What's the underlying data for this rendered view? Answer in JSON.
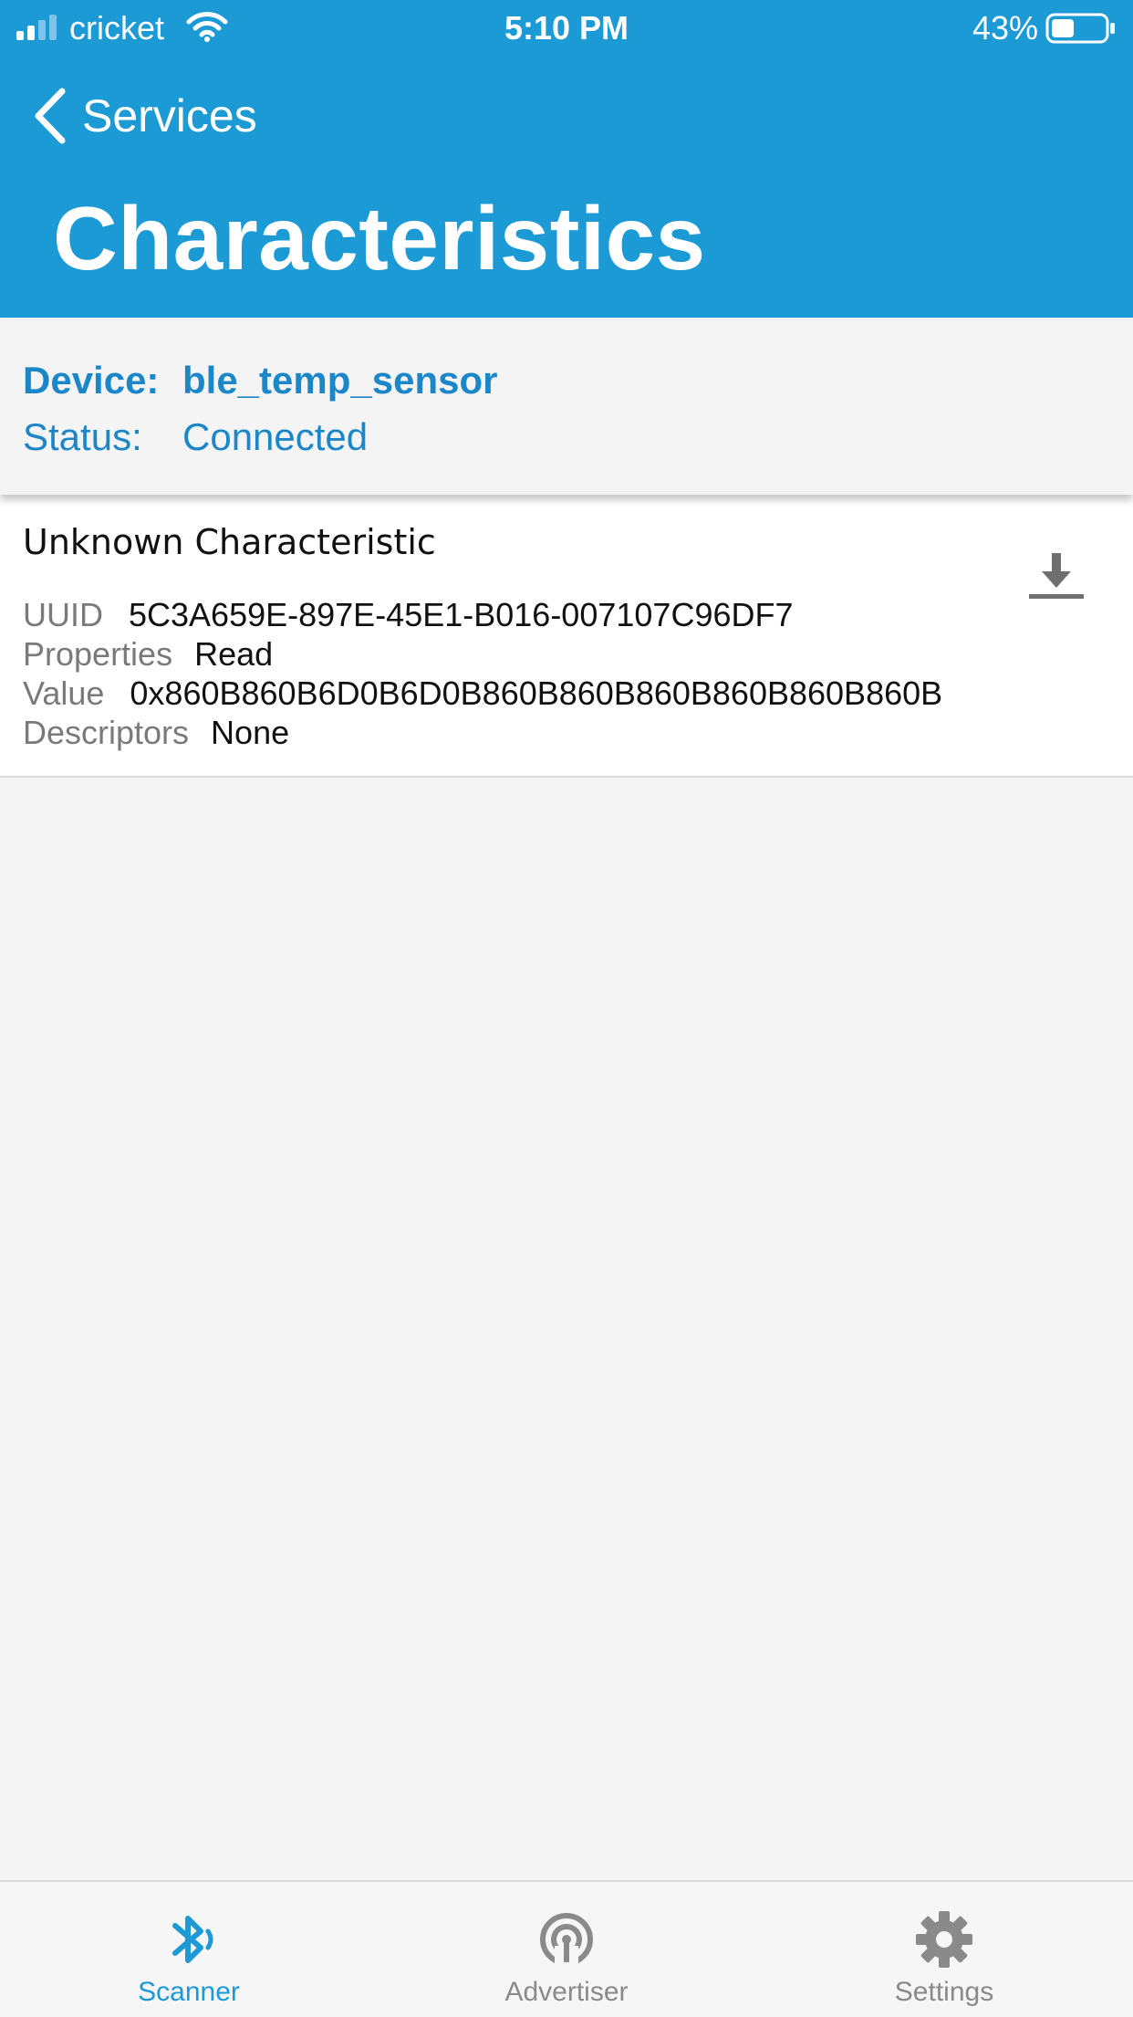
{
  "status_bar": {
    "carrier": "cricket",
    "time": "5:10 PM",
    "battery_percent": "43%",
    "battery_level": 0.43
  },
  "nav": {
    "back_label": "Services",
    "title": "Characteristics"
  },
  "device_info": {
    "device_key": "Device:",
    "device_value": "ble_temp_sensor",
    "status_key": "Status:",
    "status_value": "Connected"
  },
  "characteristics": [
    {
      "name": "Unknown Characteristic",
      "uuid_key": "UUID",
      "uuid": "5C3A659E-897E-45E1-B016-007107C96DF7",
      "properties_key": "Properties",
      "properties": "Read",
      "value_key": "Value",
      "value": "0x860B860B6D0B6D0B860B860B860B860B860B860B",
      "descriptors_key": "Descriptors",
      "descriptors": "None",
      "action_icon": "download-icon"
    }
  ],
  "tab_bar": {
    "tabs": [
      {
        "label": "Scanner",
        "icon": "bluetooth-icon",
        "active": true
      },
      {
        "label": "Advertiser",
        "icon": "broadcast-icon",
        "active": false
      },
      {
        "label": "Settings",
        "icon": "gear-icon",
        "active": false
      }
    ]
  },
  "colors": {
    "header": "#1b9ad6",
    "accent_text": "#1b86c8",
    "background": "#f4f4f4",
    "inactive_tab": "#8a8a8a"
  }
}
